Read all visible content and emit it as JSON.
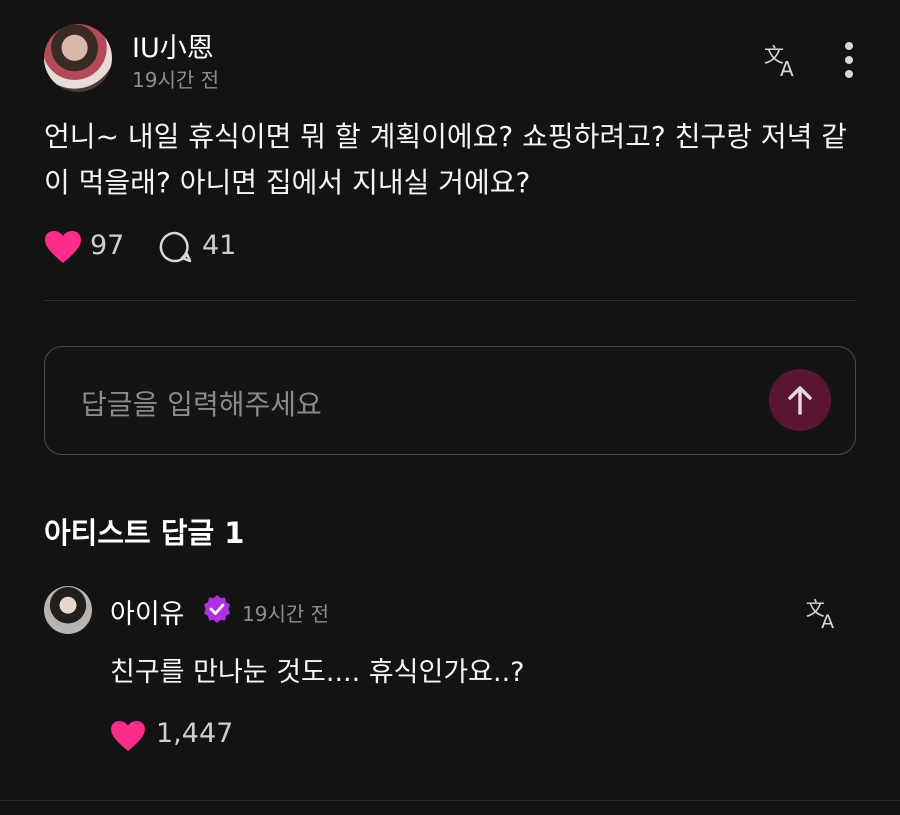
{
  "post": {
    "author": "IU小恩",
    "time": "19시간 전",
    "text": "언니~ 내일 휴식이면 뭐 할 계획이에요? 쇼핑하려고? 친구랑 저녁 같이 먹을래? 아니면 집에서 지내실 거에요?",
    "likes": "97",
    "comments": "41"
  },
  "reply_input": {
    "placeholder": "답글을 입력해주세요"
  },
  "artist_section": {
    "title": "아티스트 답글 1"
  },
  "artist_reply": {
    "author": "아이유",
    "time": "19시간 전",
    "text": "친구를 만나눈 것도.... 휴식인가요..?",
    "likes": "1,447"
  },
  "colors": {
    "background": "#131313",
    "heart": "#ff2d8a",
    "send_button": "#5a1530",
    "verified_badge": "#b02fe0"
  },
  "icons": [
    "translate-icon",
    "more-vertical-icon",
    "heart-icon",
    "comment-icon",
    "arrow-up-icon",
    "verified-badge-icon"
  ]
}
